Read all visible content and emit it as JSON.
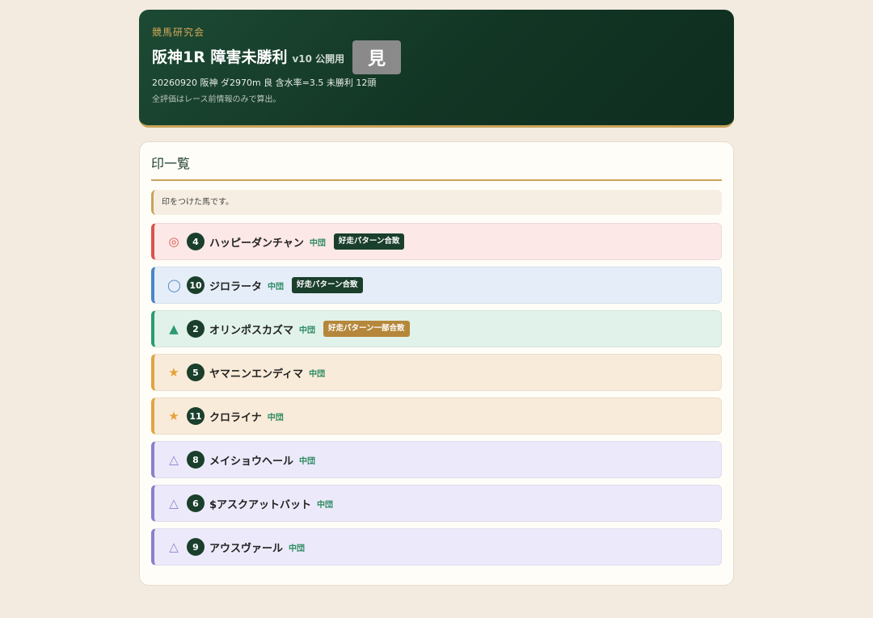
{
  "header": {
    "brand": "競馬研究会",
    "title": "阪神1R 障害未勝利",
    "version": "v10 公開用",
    "view_button": "見",
    "race_info": "20260920 阪神 ダ2970m 良 含水率=3.5 未勝利 12頭",
    "note": "全評価はレース前情報のみで算出。"
  },
  "section": {
    "title": "印一覧",
    "hint": "印をつけた馬です。"
  },
  "colors": {
    "honmei_bg": "#fce8e6",
    "honmei_border": "#d9534f",
    "honmei_mark": "#d9534f",
    "taikou_bg": "#e5eef8",
    "taikou_border": "#4a86c5",
    "taikou_mark": "#4a86c5",
    "tanana_bg": "#e1f2ea",
    "tanana_border": "#2a9b70",
    "tanana_mark": "#2a9b70",
    "hoshi_bg": "#f9ebd9",
    "hoshi_border": "#e3a342",
    "hoshi_mark": "#e8a03a",
    "renka_bg": "#eceafa",
    "renka_border": "#8a7fcf",
    "renka_mark": "#8a7fcf",
    "badge_match": "#1a3f2c",
    "badge_partial": "#b5873b"
  },
  "horses": [
    {
      "mark": "◎",
      "num": "4",
      "name": "ハッピーダンチャン",
      "rest": "中団",
      "badge": "好走パターン合致",
      "style": "honmei",
      "badge_type": "match"
    },
    {
      "mark": "◯",
      "num": "10",
      "name": "ジロラータ",
      "rest": "中団",
      "badge": "好走パターン合致",
      "style": "taikou",
      "badge_type": "match"
    },
    {
      "mark": "▲",
      "num": "2",
      "name": "オリンポスカズマ",
      "rest": "中団",
      "badge": "好走パターン一部合致",
      "style": "tanana",
      "badge_type": "partial"
    },
    {
      "mark": "★",
      "num": "5",
      "name": "ヤマニンエンディマ",
      "rest": "中団",
      "badge": "",
      "style": "hoshi",
      "badge_type": ""
    },
    {
      "mark": "★",
      "num": "11",
      "name": "クロライナ",
      "rest": "中団",
      "badge": "",
      "style": "hoshi",
      "badge_type": ""
    },
    {
      "mark": "△",
      "num": "8",
      "name": "メイショウヘール",
      "rest": "中団",
      "badge": "",
      "style": "renka",
      "badge_type": ""
    },
    {
      "mark": "△",
      "num": "6",
      "name": "$アスクアットバット",
      "rest": "中団",
      "badge": "",
      "style": "renka",
      "badge_type": ""
    },
    {
      "mark": "△",
      "num": "9",
      "name": "アウスヴァール",
      "rest": "中団",
      "badge": "",
      "style": "renka",
      "badge_type": ""
    }
  ]
}
